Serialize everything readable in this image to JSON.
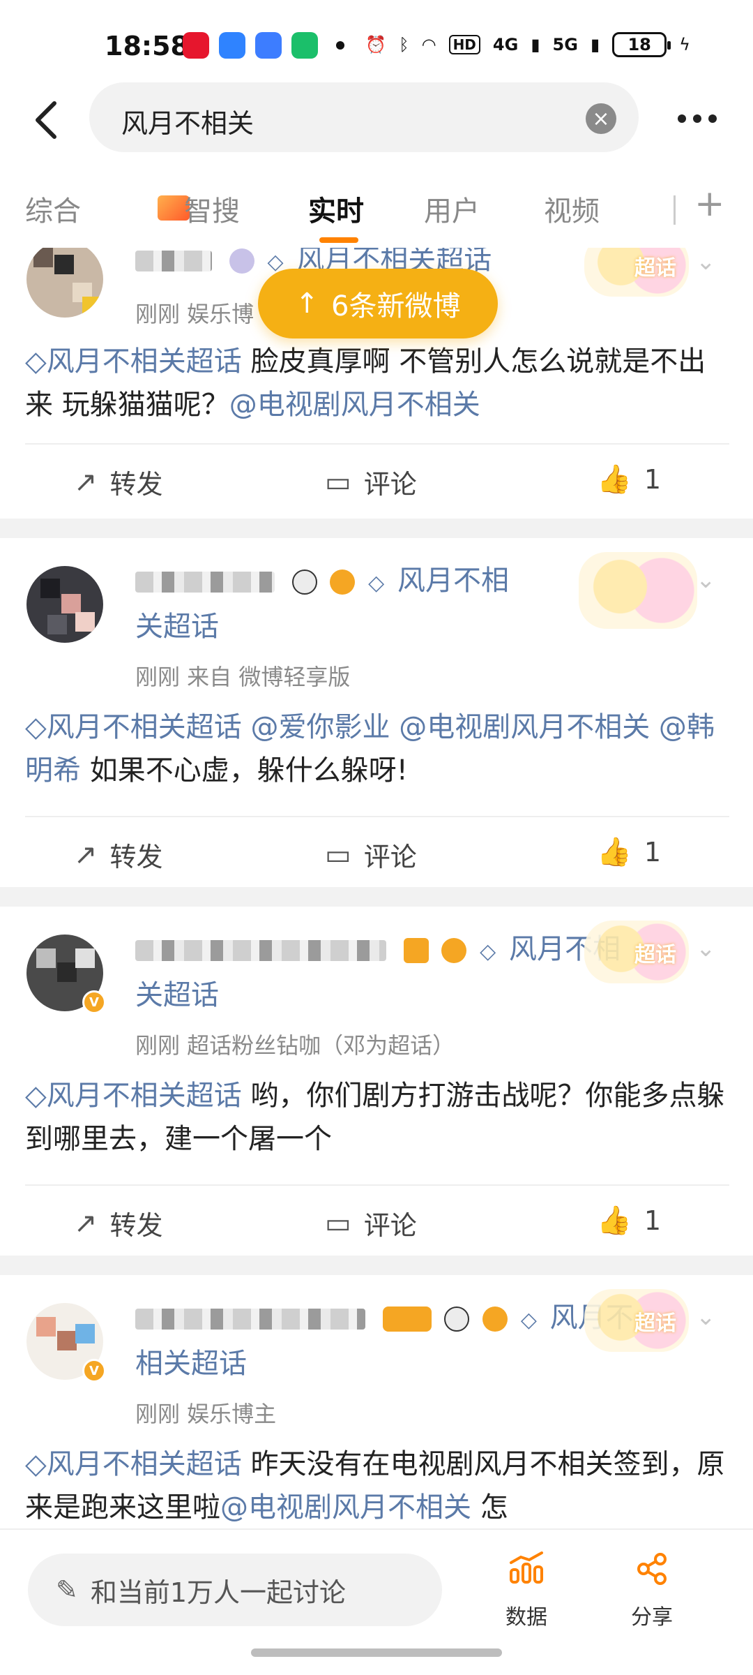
{
  "status_bar": {
    "time": "18:58",
    "network": "HD",
    "signal1": "4G",
    "signal2": "5G",
    "battery": "18",
    "app_colors": [
      "#e6162d",
      "#2f83ff",
      "#3d7dff",
      "#1bbf6a"
    ]
  },
  "search": {
    "query": "风月不相关",
    "back_icon": "back-arrow-icon",
    "clear_icon": "clear-icon",
    "more_icon": "more-icon"
  },
  "tabs": [
    {
      "label": "综合"
    },
    {
      "label": "智搜"
    },
    {
      "label": "实时",
      "active": true
    },
    {
      "label": "用户"
    },
    {
      "label": "视频"
    }
  ],
  "toast": {
    "text": "6条新微博",
    "arrow": "↑"
  },
  "posts": [
    {
      "topic": "风月不相关超话",
      "meta": "刚刚  娱乐博",
      "body_topic": "风月不相关超话",
      "body_text": " 脸皮真厚啊 不管别人怎么说就是不出来 玩躲猫猫呢？",
      "body_mention": "@电视剧风月不相关",
      "repost": "转发",
      "comment": "评论",
      "likes": "1",
      "sticker": "超话"
    },
    {
      "topic": "风月不相关超话",
      "meta": "刚刚  来自 微博轻享版",
      "body_topic": "风月不相关超话",
      "body_mentions": "@爱你影业 @电视剧风月不相关 @韩明希",
      "body_text": " 如果不心虚，躲什么躲呀!",
      "repost": "转发",
      "comment": "评论",
      "likes": "1"
    },
    {
      "topic": "风月不相关超话",
      "meta": "刚刚  超话粉丝钻咖（邓为超话）",
      "body_topic": "风月不相关超话",
      "body_text": " 哟，你们剧方打游击战呢？你能多点躲到哪里去，建一个屠一个",
      "repost": "转发",
      "comment": "评论",
      "likes": "1",
      "sticker": "超话"
    },
    {
      "topic": "风月不相关超话",
      "meta": "刚刚  娱乐博主",
      "body_topic": "风月不相关超话",
      "body_text": " 昨天没有在电视剧风月不相关签到，原来是跑来这里啦",
      "body_mention": "@电视剧风月不相关",
      "body_tail": " 怎",
      "sticker": "超话"
    }
  ],
  "bottom": {
    "discuss_placeholder": "和当前1万人一起讨论",
    "data_label": "数据",
    "share_label": "分享"
  },
  "colors": {
    "accent": "#ff8200",
    "link": "#5b7aa8",
    "toast": "#f5b014"
  }
}
